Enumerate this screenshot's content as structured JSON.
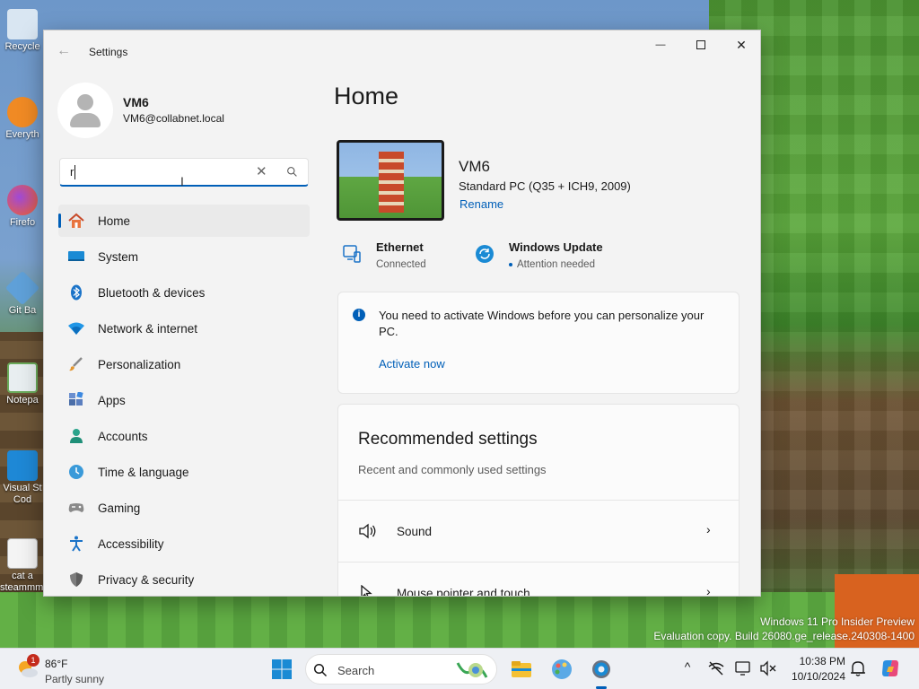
{
  "desktop": {
    "icons": [
      {
        "label": "Recycle",
        "name": "recycle-bin"
      },
      {
        "label": "Everyth",
        "name": "everything"
      },
      {
        "label": "Firefo",
        "name": "firefox"
      },
      {
        "label": "Git Ba",
        "name": "git-bash"
      },
      {
        "label": "Notepa",
        "name": "notepad"
      },
      {
        "label": "Visual St Cod",
        "name": "vscode"
      },
      {
        "label": "cat a steammm...",
        "name": "cat-file"
      }
    ],
    "watermark_line1": "Windows 11 Pro Insider Preview",
    "watermark_line2": "Evaluation copy. Build 26080.ge_release.240308-1400"
  },
  "window": {
    "title": "Settings",
    "back_glyph": "←",
    "minimize_glyph": "—",
    "close_glyph": "✕"
  },
  "profile": {
    "name": "VM6",
    "email": "VM6@collabnet.local"
  },
  "search": {
    "value": "r",
    "clear_glyph": "✕"
  },
  "nav": {
    "items": [
      {
        "label": "Home"
      },
      {
        "label": "System"
      },
      {
        "label": "Bluetooth & devices"
      },
      {
        "label": "Network & internet"
      },
      {
        "label": "Personalization"
      },
      {
        "label": "Apps"
      },
      {
        "label": "Accounts"
      },
      {
        "label": "Time & language"
      },
      {
        "label": "Gaming"
      },
      {
        "label": "Accessibility"
      },
      {
        "label": "Privacy & security"
      }
    ]
  },
  "main": {
    "title": "Home",
    "pc": {
      "name": "VM6",
      "model": "Standard PC (Q35 + ICH9, 2009)",
      "rename": "Rename"
    },
    "status": {
      "ethernet_title": "Ethernet",
      "ethernet_sub": "Connected",
      "update_title": "Windows Update",
      "update_sub": "Attention needed"
    },
    "activate": {
      "message": "You need to activate Windows before you can personalize your PC.",
      "link": "Activate now",
      "info_glyph": "i"
    },
    "recommended": {
      "title": "Recommended settings",
      "subtitle": "Recent and commonly used settings",
      "rows": [
        {
          "label": "Sound"
        },
        {
          "label": "Mouse pointer and touch"
        }
      ],
      "chevron_glyph": "›"
    }
  },
  "taskbar": {
    "weather_temp": "86°F",
    "weather_desc": "Partly sunny",
    "weather_badge": "1",
    "search_label": "Search",
    "time": "10:38 PM",
    "date": "10/10/2024",
    "tray_chevron": "^"
  },
  "colors": {
    "accent": "#005fb8",
    "window_bg": "#f3f3f3",
    "card_bg": "#fbfbfb",
    "badge": "#c42b1c"
  }
}
